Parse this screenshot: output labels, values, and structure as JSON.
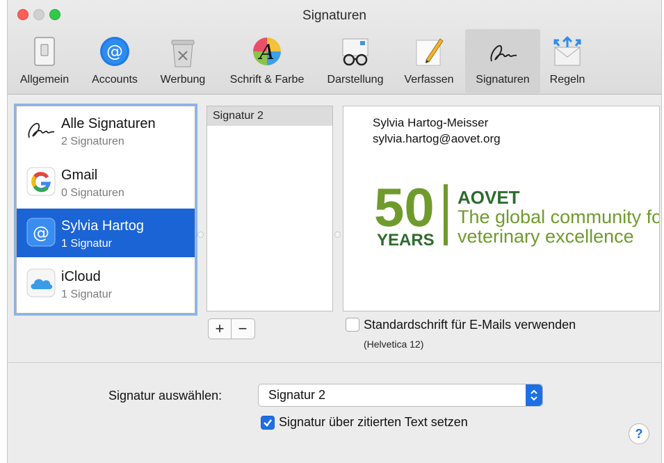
{
  "window": {
    "title": "Signaturen"
  },
  "toolbar": {
    "items": [
      {
        "label": "Allgemein",
        "icon": "switch-icon"
      },
      {
        "label": "Accounts",
        "icon": "at-icon"
      },
      {
        "label": "Werbung",
        "icon": "trash-icon"
      },
      {
        "label": "Schrift & Farbe",
        "icon": "font-color-icon"
      },
      {
        "label": "Darstellung",
        "icon": "glasses-icon"
      },
      {
        "label": "Verfassen",
        "icon": "pencil-icon"
      },
      {
        "label": "Signaturen",
        "icon": "signature-icon",
        "selected": true
      },
      {
        "label": "Regeln",
        "icon": "rules-icon"
      }
    ]
  },
  "accounts": [
    {
      "name": "Alle Signaturen",
      "count": "2 Signaturen",
      "icon": "signature-icon"
    },
    {
      "name": "Gmail",
      "count": "0 Signaturen",
      "icon": "google-icon"
    },
    {
      "name": "Sylvia Hartog",
      "count": "1 Signatur",
      "icon": "at-icon",
      "selected": true
    },
    {
      "name": "iCloud",
      "count": "1 Signatur",
      "icon": "cloud-icon"
    }
  ],
  "signatures": [
    {
      "name": "Signatur 2",
      "selected": true
    }
  ],
  "preview": {
    "name": "Sylvia Hartog-Meisser",
    "email": "sylvia.hartog@aovet.org",
    "logo": {
      "number": "50",
      "years": "YEARS",
      "brand": "AOVET",
      "tagline1": "The global community fo",
      "tagline2": "veterinary excellence",
      "color_green": "#6f9b2c",
      "color_dark": "#2e6b2e"
    }
  },
  "buttons": {
    "add": "+",
    "remove": "−",
    "help": "?"
  },
  "font_option": {
    "label": "Standardschrift für E-Mails verwenden",
    "sub": "(Helvetica 12)",
    "checked": false
  },
  "select": {
    "label": "Signatur auswählen:",
    "value": "Signatur 2"
  },
  "quote_option": {
    "label": "Signatur über zitierten Text setzen",
    "checked": true
  },
  "colors": {
    "accent": "#1d6fe6",
    "selection": "#1b64d6",
    "close": "#fc5f57",
    "maximize": "#34c84a"
  }
}
